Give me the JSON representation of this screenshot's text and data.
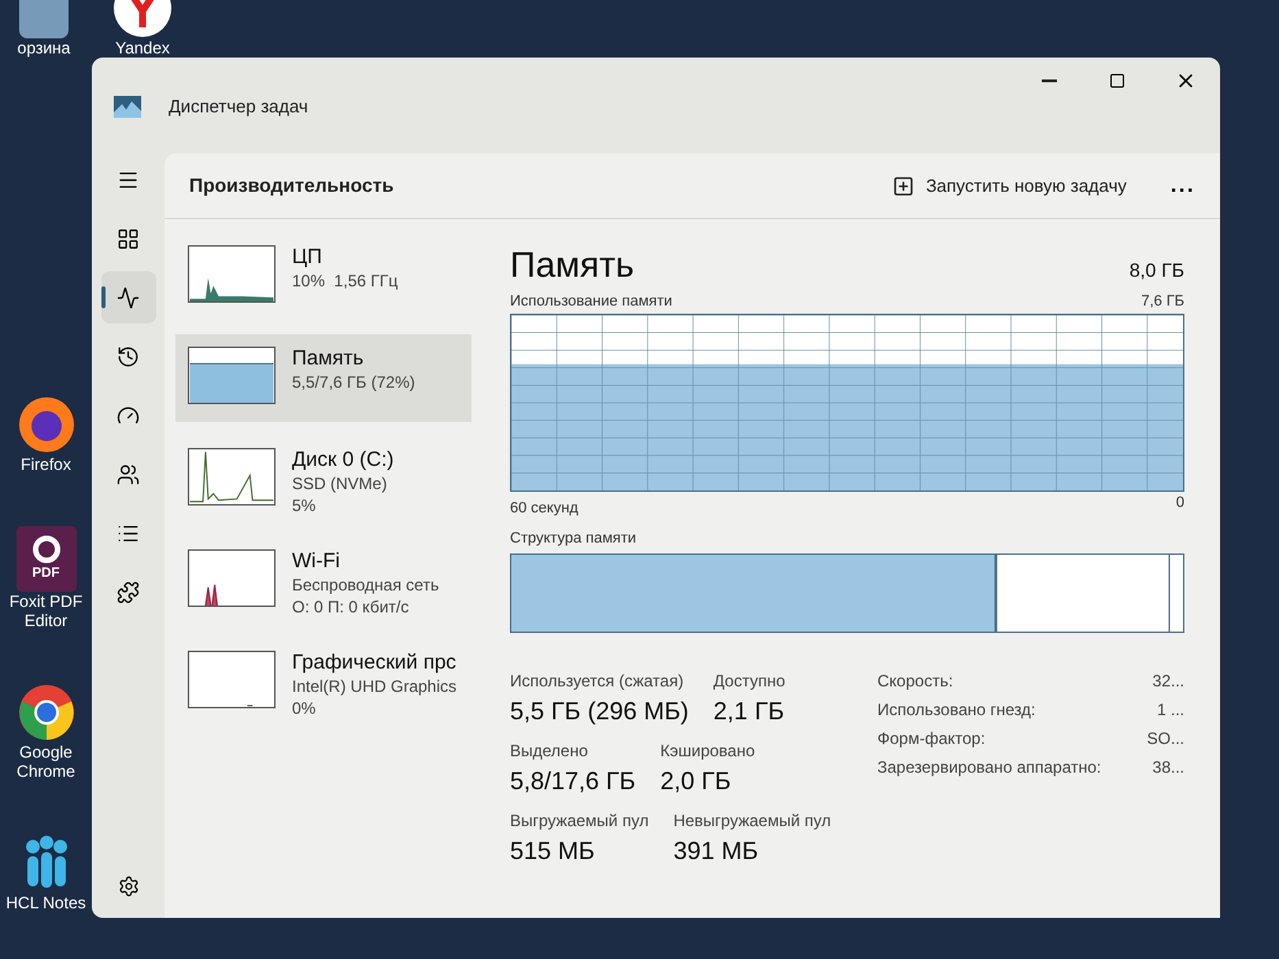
{
  "desktop": {
    "top_icons": [
      {
        "label": "орзина",
        "kind": "bin"
      },
      {
        "label": "Yandex",
        "kind": "yandex"
      }
    ],
    "side_icons": [
      {
        "label": "Firefox",
        "kind": "firefox"
      },
      {
        "label": "Foxit PDF Editor",
        "kind": "pdf",
        "badge": "PDF"
      },
      {
        "label": "Google Chrome",
        "kind": "chrome"
      },
      {
        "label": "HCL Notes",
        "kind": "notes"
      }
    ]
  },
  "window": {
    "title": "Диспетчер задач"
  },
  "nav": [
    {
      "selected": false
    },
    {
      "selected": false
    },
    {
      "selected": true
    },
    {
      "selected": false
    },
    {
      "selected": false
    },
    {
      "selected": false
    },
    {
      "selected": false
    },
    {
      "selected": false
    }
  ],
  "header": {
    "title": "Производительность",
    "new_task_button": "Запустить новую задачу",
    "more_button": "..."
  },
  "resources": [
    {
      "kind": "cpu",
      "name": "ЦП",
      "lines": [
        "10%  1,56 ГГц"
      ],
      "selected": false
    },
    {
      "kind": "memory",
      "name": "Память",
      "lines": [
        "5,5/7,6 ГБ (72%)"
      ],
      "selected": true
    },
    {
      "kind": "disk",
      "name": "Диск 0 (C:)",
      "lines": [
        "SSD (NVMe)",
        "5%"
      ],
      "selected": false
    },
    {
      "kind": "wifi",
      "name": "Wi-Fi",
      "lines": [
        "Беспроводная сеть",
        "О: 0 П: 0 кбит/с"
      ],
      "selected": false
    },
    {
      "kind": "gpu",
      "name": "Графический прс",
      "lines": [
        "Intel(R) UHD Graphics",
        "0%"
      ],
      "selected": false
    }
  ],
  "detail": {
    "title": "Память",
    "total": "8,0 ГБ",
    "usage_label": "Использование памяти",
    "usage_max": "7,6 ГБ",
    "time_label": "60 секунд",
    "zero_label": "0",
    "structure_label": "Структура памяти",
    "stats": [
      [
        {
          "label": "Используется (сжатая)",
          "value": "5,5 ГБ (296 МБ)"
        },
        {
          "label": "Доступно",
          "value": "2,1 ГБ"
        }
      ],
      [
        {
          "label": "Выделено",
          "value": "5,8/17,6 ГБ"
        },
        {
          "label": "Кэшировано",
          "value": "2,0 ГБ"
        }
      ],
      [
        {
          "label": "Выгружаемый пул",
          "value": "515 МБ"
        },
        {
          "label": "Невыгружаемый пул",
          "value": "391 МБ"
        }
      ]
    ],
    "specs": [
      {
        "label": "Скорость:",
        "value": "32..."
      },
      {
        "label": "Использовано гнезд:",
        "value": "1 ..."
      },
      {
        "label": "Форм-фактор:",
        "value": "SO..."
      },
      {
        "label": "Зарезервировано аппаратно:",
        "value": "38..."
      }
    ]
  }
}
